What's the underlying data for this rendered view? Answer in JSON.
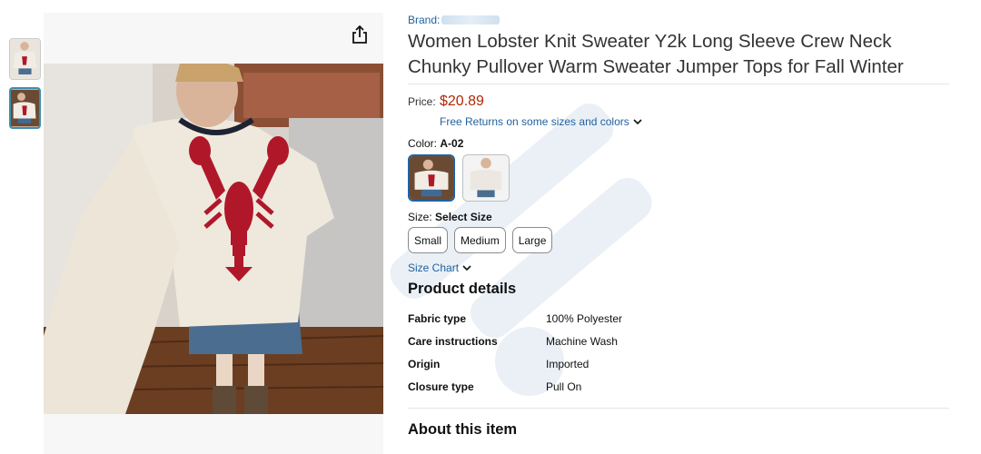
{
  "product": {
    "brand_label": "Brand:",
    "title": "Women Lobster Knit Sweater Y2k Long Sleeve Crew Neck Chunky Pullover Warm Sweater Jumper Tops for Fall Winter"
  },
  "price": {
    "label": "Price:",
    "amount": "$20.89",
    "free_returns": "Free Returns on some sizes and colors"
  },
  "color": {
    "label": "Color:",
    "selected": "A-02"
  },
  "size": {
    "label": "Size:",
    "prompt": "Select Size",
    "options": [
      "Small",
      "Medium",
      "Large"
    ],
    "chart_link": "Size Chart"
  },
  "details": {
    "heading": "Product details",
    "rows": [
      {
        "key": "Fabric type",
        "value": "100% Polyester"
      },
      {
        "key": "Care instructions",
        "value": "Machine Wash"
      },
      {
        "key": "Origin",
        "value": "Imported"
      },
      {
        "key": "Closure type",
        "value": "Pull On"
      }
    ]
  },
  "about": {
    "heading": "About this item"
  },
  "icons": {
    "share": "share-icon",
    "chevron": "chevron-down-icon"
  },
  "colors": {
    "link": "#2162a1",
    "price": "#b12704",
    "sweater": "#efe9dd",
    "lobster": "#b0182a",
    "selected_border": "#2162a1"
  }
}
